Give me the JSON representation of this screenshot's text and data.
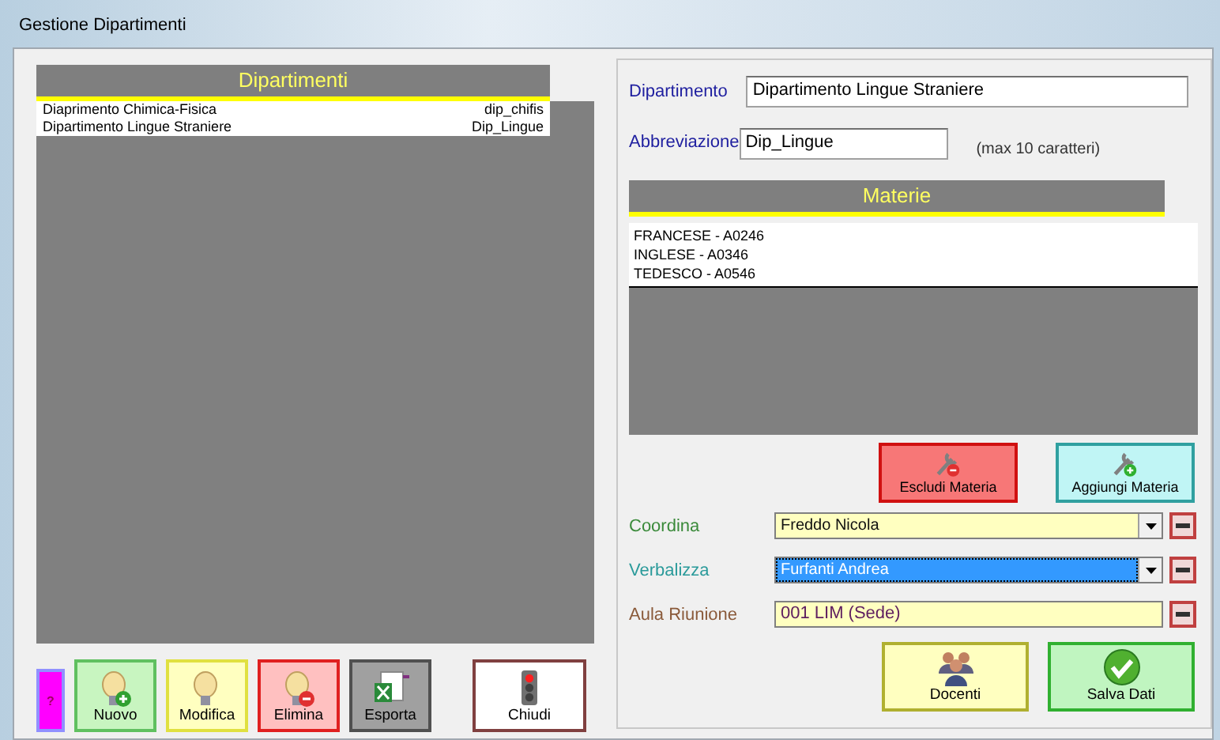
{
  "window": {
    "title": "Gestione Dipartimenti"
  },
  "departments": {
    "header": "Dipartimenti",
    "rows": [
      {
        "name": "Diaprimento Chimica-Fisica",
        "code": "dip_chifis"
      },
      {
        "name": "Dipartimento Lingue Straniere",
        "code": "Dip_Lingue"
      }
    ]
  },
  "left_buttons": [
    {
      "kind": "help",
      "label": "?",
      "color": "#ff00ff"
    },
    {
      "kind": "bulb-plus",
      "label": "Nuovo",
      "color": "#c8f5c0"
    },
    {
      "kind": "bulb",
      "label": "Modifica",
      "color": "#ffffc0"
    },
    {
      "kind": "bulb-minus",
      "label": "Elimina",
      "color": "#ffc0c0"
    },
    {
      "kind": "excel",
      "label": "Esporta",
      "color": "#a0a0a0"
    },
    {
      "kind": "traffic-light",
      "label": "Chiudi",
      "color": "#ffffff"
    }
  ],
  "form": {
    "department_label": "Dipartimento",
    "department_value": "Dipartimento Lingue Straniere",
    "abbr_label": "Abbreviazione",
    "abbr_value": "Dip_Lingue",
    "abbr_hint": "(max 10 caratteri)"
  },
  "subjects": {
    "header": "Materie",
    "rows": [
      "FRANCESE - A0246",
      "INGLESE - A0346",
      "TEDESCO - A0546"
    ]
  },
  "subject_buttons": [
    {
      "kind": "wrench-minus",
      "label": "Escludi Materia",
      "color": "#f77777"
    },
    {
      "kind": "wrench-plus",
      "label": "Aggiungi Materia",
      "color": "#c0f5f5"
    }
  ],
  "fields": [
    {
      "kind": "combo",
      "label": "Coordina",
      "color": "#3a8a3a",
      "value": "Freddo Nicola",
      "selected": false
    },
    {
      "kind": "combo",
      "label": "Verbalizza",
      "color": "#2a9a9a",
      "value": "Furfanti Andrea",
      "selected": true
    },
    {
      "kind": "text",
      "label": "Aula Riunione",
      "color": "#8a5a3a",
      "value": "001 LIM (Sede)",
      "selected": false
    }
  ],
  "bottom_buttons": [
    {
      "kind": "people",
      "label": "Docenti",
      "color": "#ffffc0"
    },
    {
      "kind": "check",
      "label": "Salva Dati",
      "color": "#c0f5c0"
    }
  ]
}
